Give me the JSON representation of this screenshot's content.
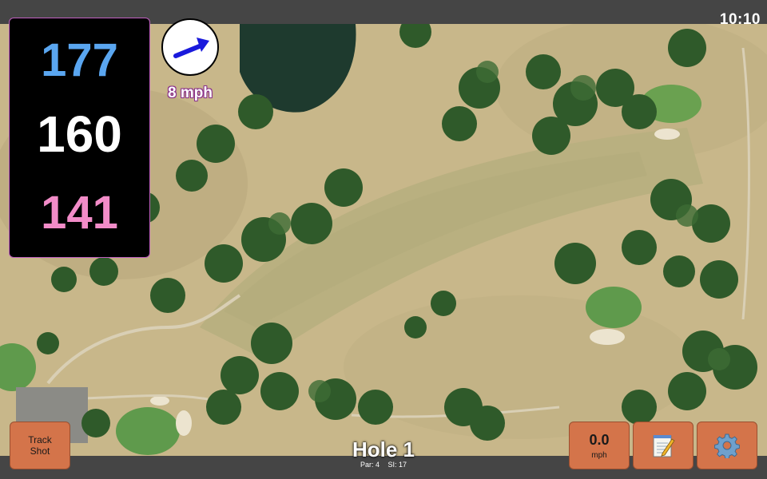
{
  "status_bar": {
    "time": "10:10"
  },
  "distances": {
    "back": "177",
    "middle": "160",
    "front": "141"
  },
  "wind": {
    "speed": "8 mph",
    "direction_icon": "arrow-icon"
  },
  "buttons": {
    "track_shot": {
      "line1": "Track",
      "line2": "Shot"
    },
    "speed": {
      "value": "0.0",
      "unit": "mph"
    },
    "notes": {
      "icon": "notepad-icon"
    },
    "settings": {
      "icon": "gear-icon"
    }
  },
  "hole": {
    "title": "Hole 1",
    "par": "Par: 4",
    "si": "SI: 17"
  },
  "colors": {
    "back_distance": "#5aa6f0",
    "middle_distance": "#ffffff",
    "front_distance": "#f28cc8",
    "button": "#d4744a",
    "panel_border": "#c05fc0"
  }
}
